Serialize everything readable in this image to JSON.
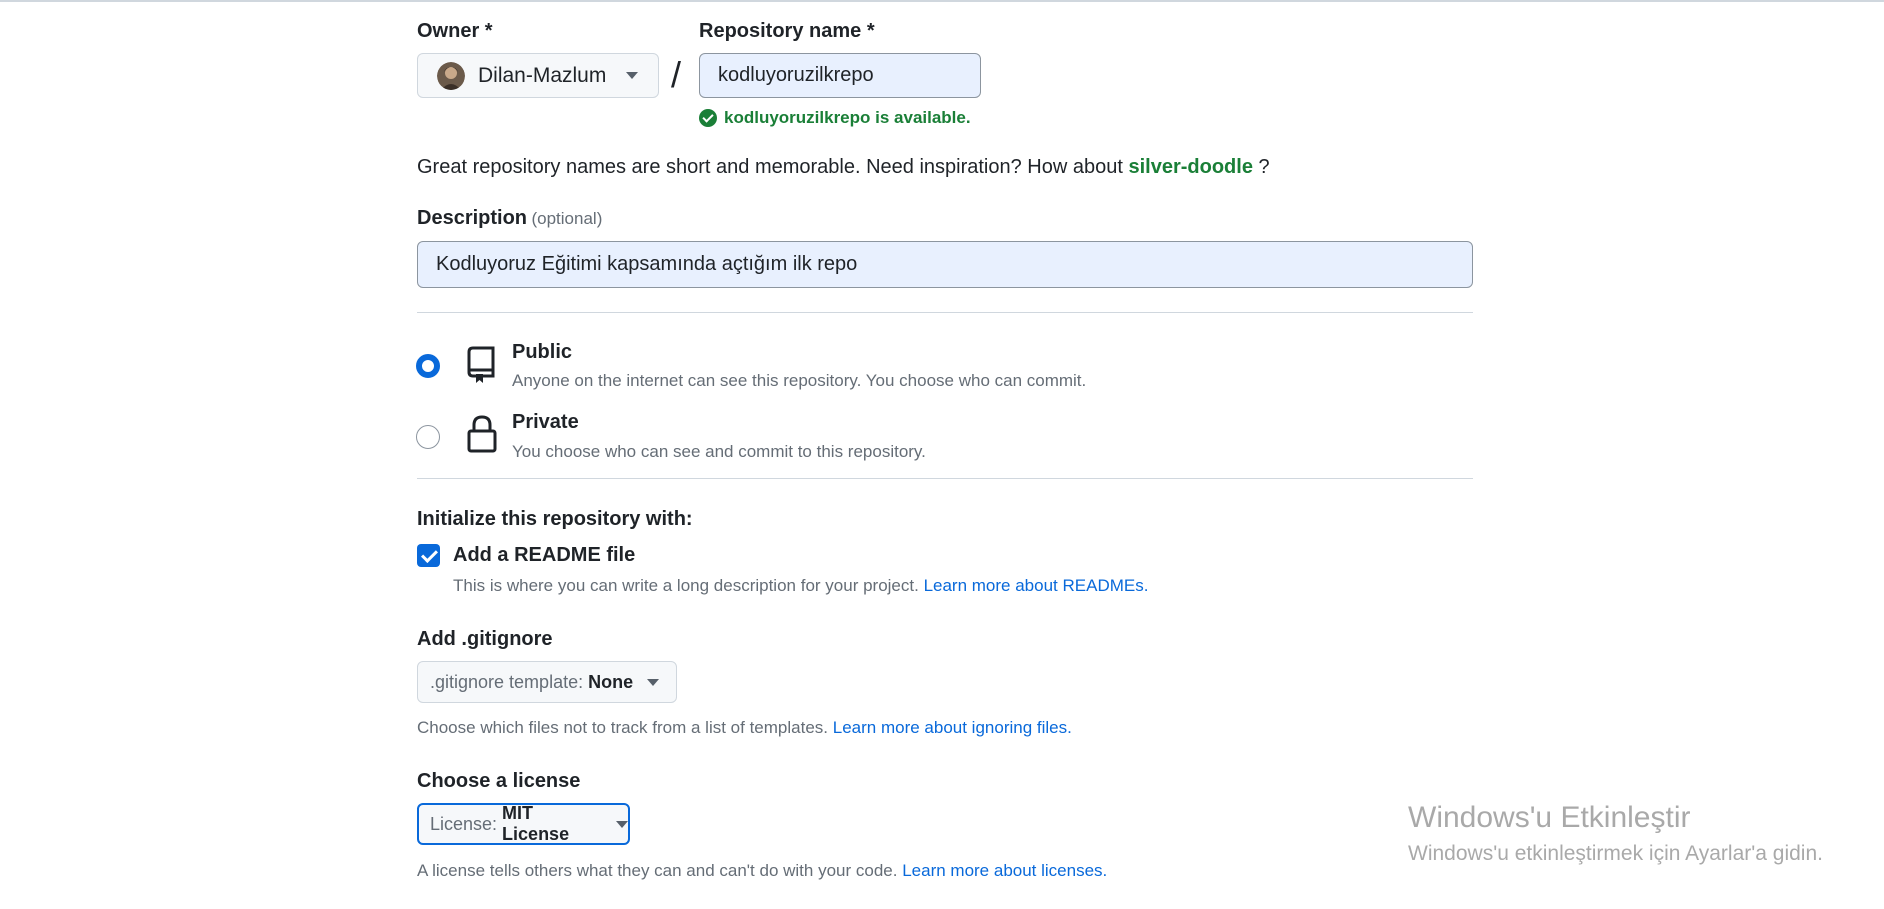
{
  "owner": {
    "label": "Owner *",
    "name": "Dilan-Mazlum"
  },
  "repo": {
    "label": "Repository name *",
    "value": "kodluyoruzilkrepo",
    "availability": "kodluyoruzilkrepo is available."
  },
  "separator": "/",
  "suggestion": {
    "text": "Great repository names are short and memorable. Need inspiration? How about",
    "name": "silver-doodle",
    "suffix": "?"
  },
  "description": {
    "label": "Description",
    "optional": "(optional)",
    "value": "Kodluyoruz Eğitimi kapsamında açtığım ilk repo"
  },
  "visibility": {
    "public": {
      "label": "Public",
      "desc": "Anyone on the internet can see this repository. You choose who can commit.",
      "icon": "repo-icon",
      "selected": true
    },
    "private": {
      "label": "Private",
      "desc": "You choose who can see and commit to this repository.",
      "icon": "lock-icon",
      "selected": false
    }
  },
  "init": {
    "heading": "Initialize this repository with:",
    "readme_label": "Add a README file",
    "readme_checked": true,
    "readme_desc": "This is where you can write a long description for your project.",
    "readme_link": "Learn more about READMEs."
  },
  "gitignore": {
    "heading": "Add .gitignore",
    "select_key": ".gitignore template:",
    "select_value": "None",
    "desc": "Choose which files not to track from a list of templates.",
    "link": "Learn more about ignoring files."
  },
  "license": {
    "heading": "Choose a license",
    "select_key": "License:",
    "select_value": "MIT License",
    "desc": "A license tells others what they can and can't do with your code.",
    "link": "Learn more about licenses."
  },
  "watermark": {
    "title": "Windows'u Etkinleştir",
    "subtitle": "Windows'u etkinleştirmek için Ayarlar'a gidin."
  },
  "colors": {
    "accent": "#0969da",
    "success": "#1a7f37",
    "border": "#d0d7de"
  }
}
